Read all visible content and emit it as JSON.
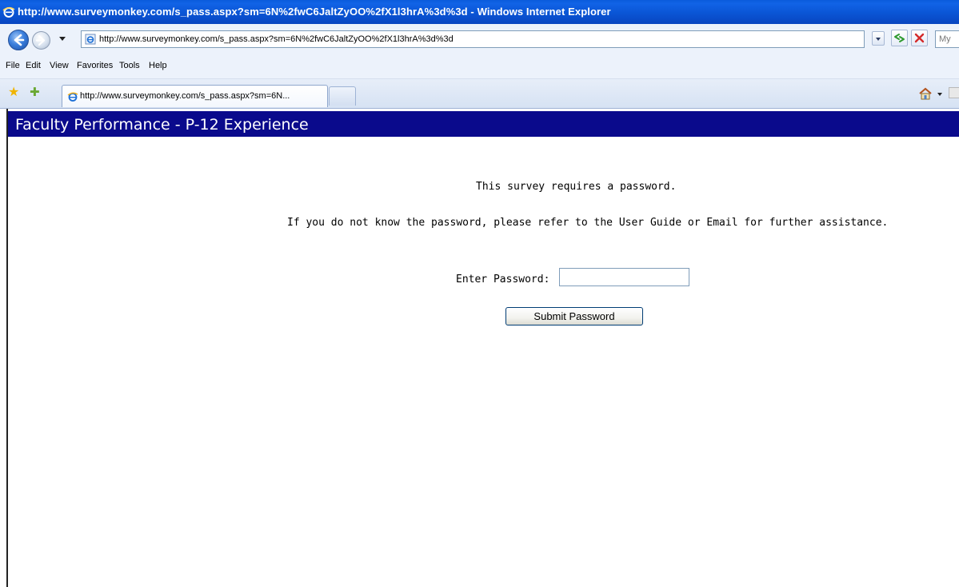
{
  "window": {
    "title": "http://www.surveymonkey.com/s_pass.aspx?sm=6N%2fwC6JaltZyOO%2fX1l3hrA%3d%3d - Windows Internet Explorer"
  },
  "address_bar": {
    "url": "http://www.surveymonkey.com/s_pass.aspx?sm=6N%2fwC6JaltZyOO%2fX1l3hrA%3d%3d",
    "search_placeholder": "My"
  },
  "menu": {
    "items": [
      "File",
      "Edit",
      "View",
      "Favorites",
      "Tools",
      "Help"
    ]
  },
  "tabs": {
    "active_label": "http://www.surveymonkey.com/s_pass.aspx?sm=6N..."
  },
  "page": {
    "banner_title": "Faculty Performance - P-12 Experience",
    "requires_password": "This survey requires a password.",
    "help_text": "If you do not know the password, please refer to the User Guide or Email for further assistance.",
    "password_label": "Enter Password:",
    "password_value": "",
    "submit_label": "Submit Password"
  },
  "colors": {
    "banner_bg": "#0a0a8c",
    "titlebar": "#0a55d5"
  }
}
